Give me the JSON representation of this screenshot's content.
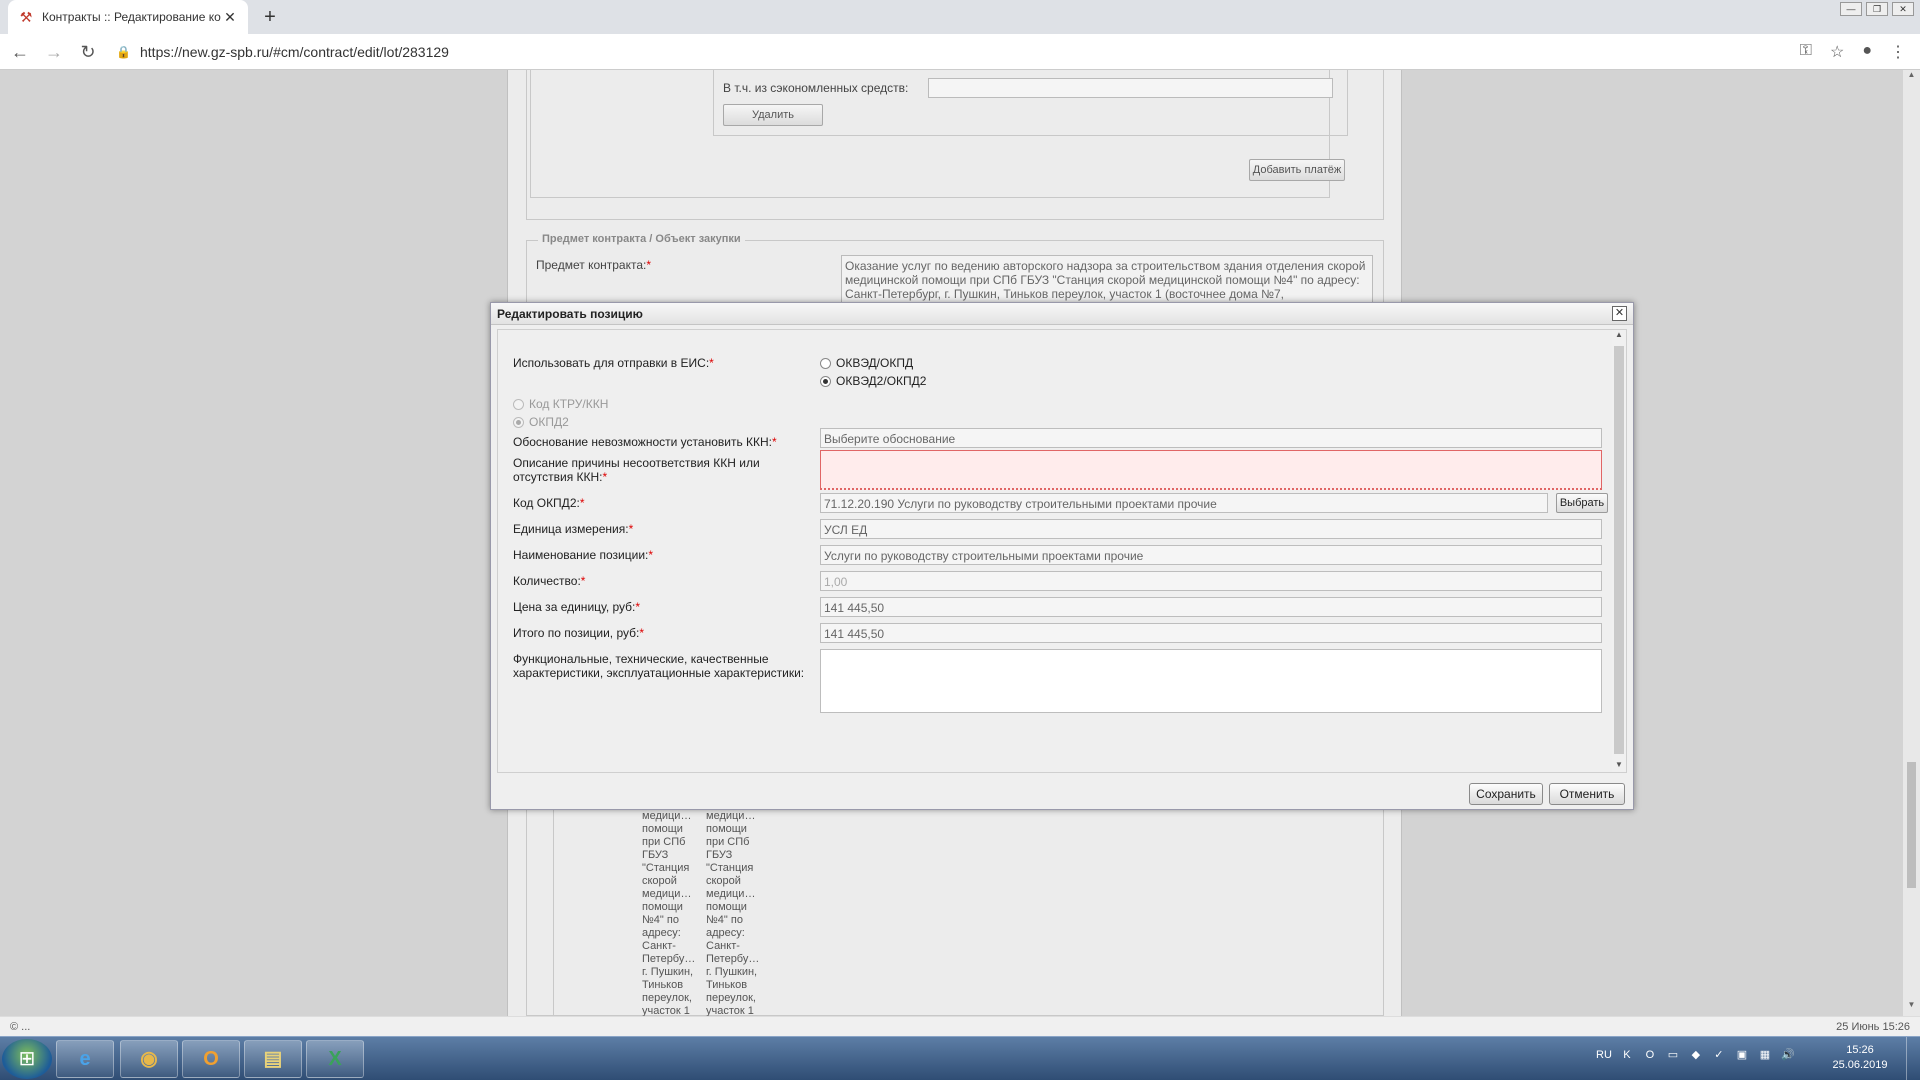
{
  "browser": {
    "tab_title": "Контракты :: Редактирование ко",
    "url": "https://new.gz-spb.ru/#cm/contract/edit/lot/283129"
  },
  "background": {
    "saved_funds_label": "В т.ч. из сэкономленных средств:",
    "delete_button": "Удалить",
    "add_payment_button": "Добавить платёж",
    "section_legend": "Предмет контракта / Объект закупки",
    "subject_label": "Предмет контракта:",
    "subject_value": "Оказание услуг по ведению авторского надзора за строительством здания отделения скорой медицинской помощи при СПб ГБУЗ \"Станция  скорой медицинской помощи №4\" по адресу: Санкт-Петербург, г. Пушкин, Тиньков переулок, участок 1 (восточнее дома №7,",
    "grid_col1": "медици…\nпомощи\nпри СПб\nГБУЗ\n\"Станция\nскорой\nмедици…\nпомощи\n№4\" по\nадресу:\nСанкт-\nПетербу…\nг. Пушкин,\nТиньков\nпереулок,\nучасток 1",
    "grid_col2": "медици…\nпомощи\nпри СПб\nГБУЗ\n\"Станция\nскорой\nмедици…\nпомощи\n№4\" по\nадресу:\nСанкт-\nПетербу…\nг. Пушкин,\nТиньков\nпереулок,\nучасток 1"
  },
  "modal": {
    "title": "Редактировать позицию",
    "use_for_eis_label": "Использовать для отправки в ЕИС:",
    "radio_okved_okpd": "ОКВЭД/ОКПД",
    "radio_okved2_okpd2": "ОКВЭД2/ОКПД2",
    "radio_ktru": "Код КТРУ/ККН",
    "radio_okpd2": "ОКПД2",
    "fields": {
      "justification_label": "Обоснование невозможности установить ККН:",
      "justification_placeholder": "Выберите обоснование",
      "reason_label": "Описание причины несоответствия ККН или отсутствия ККН:",
      "okpd2_label": "Код ОКПД2:",
      "okpd2_value": "71.12.20.190 Услуги по руководству строительными проектами прочие",
      "okpd2_button": "Выбрать",
      "unit_label": "Единица измерения:",
      "unit_value": "УСЛ ЕД",
      "name_label": "Наименование позиции:",
      "name_value": "Услуги по руководству строительными проектами прочие",
      "qty_label": "Количество:",
      "qty_value": "1,00",
      "price_label": "Цена за единицу, руб:",
      "price_value": "141 445,50",
      "total_label": "Итого по позиции, руб:",
      "total_value": "141 445,50",
      "chars_label": "Функциональные, технические, качественные характеристики, эксплуатационные характеристики:"
    },
    "save_button": "Сохранить",
    "cancel_button": "Отменить"
  },
  "status": {
    "left": "© ...",
    "right": "25 Июнь 15:26"
  },
  "taskbar": {
    "lang": "RU",
    "time": "15:26",
    "date": "25.06.2019"
  },
  "colors": {
    "required": "#dd0000",
    "invalid_bg": "#ffecec",
    "taskbar": "#3a5a85"
  }
}
